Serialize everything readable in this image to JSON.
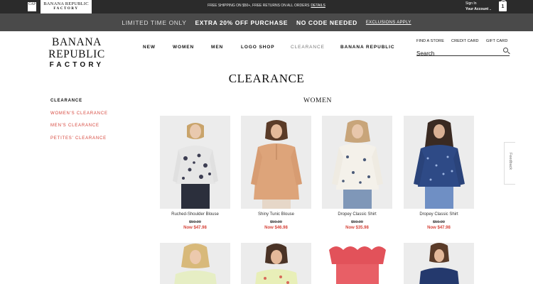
{
  "topbar": {
    "gap_logo": "GAP",
    "brf_line1": "BANANA REPUBLIC",
    "brf_line2": "FACTORY",
    "shipping_text": "FREE SHIPPING ON $50+, FREE RETURNS ON ALL ORDERS",
    "shipping_link": "DETAILS",
    "signin": "Sign In",
    "account": "Your Account",
    "bag_count": "1"
  },
  "promo": {
    "limited": "LIMITED TIME ONLY",
    "offer": "EXTRA 20% OFF PURCHASE",
    "nocode": "NO CODE NEEDED",
    "exclusions": "EXCLUSIONS APPLY"
  },
  "header": {
    "brand_line1": "BANANA REPUBLIC",
    "brand_line2": "FACTORY",
    "nav": [
      "NEW",
      "WOMEN",
      "MEN",
      "LOGO SHOP",
      "CLEARANCE",
      "BANANA REPUBLIC"
    ],
    "util": [
      "FIND A STORE",
      "CREDIT CARD",
      "GIFT CARD"
    ],
    "search_placeholder": "Search"
  },
  "page": {
    "title": "CLEARANCE",
    "section": "WOMEN"
  },
  "sidebar": {
    "heading": "CLEARANCE",
    "links": [
      "WOMEN'S CLEARANCE",
      "MEN'S CLEARANCE",
      "PETITES' CLEARANCE"
    ]
  },
  "products": [
    {
      "name": "Ruched-Shoulder Blouse",
      "orig": "$59.99",
      "now": "Now $47.98"
    },
    {
      "name": "Shiny Tunic Blouse",
      "orig": "$59.99",
      "now": "Now $46.98"
    },
    {
      "name": "Dropey Classic Shirt",
      "orig": "$59.99",
      "now": "Now $35.98"
    },
    {
      "name": "Dropey Classic Shirt",
      "orig": "$59.99",
      "now": "Now $47.98"
    }
  ],
  "feedback": "Feedback",
  "colors": {
    "topbar": "#2b2b2b",
    "promo": "#4a4a4a",
    "sale_red": "#d6443a"
  }
}
